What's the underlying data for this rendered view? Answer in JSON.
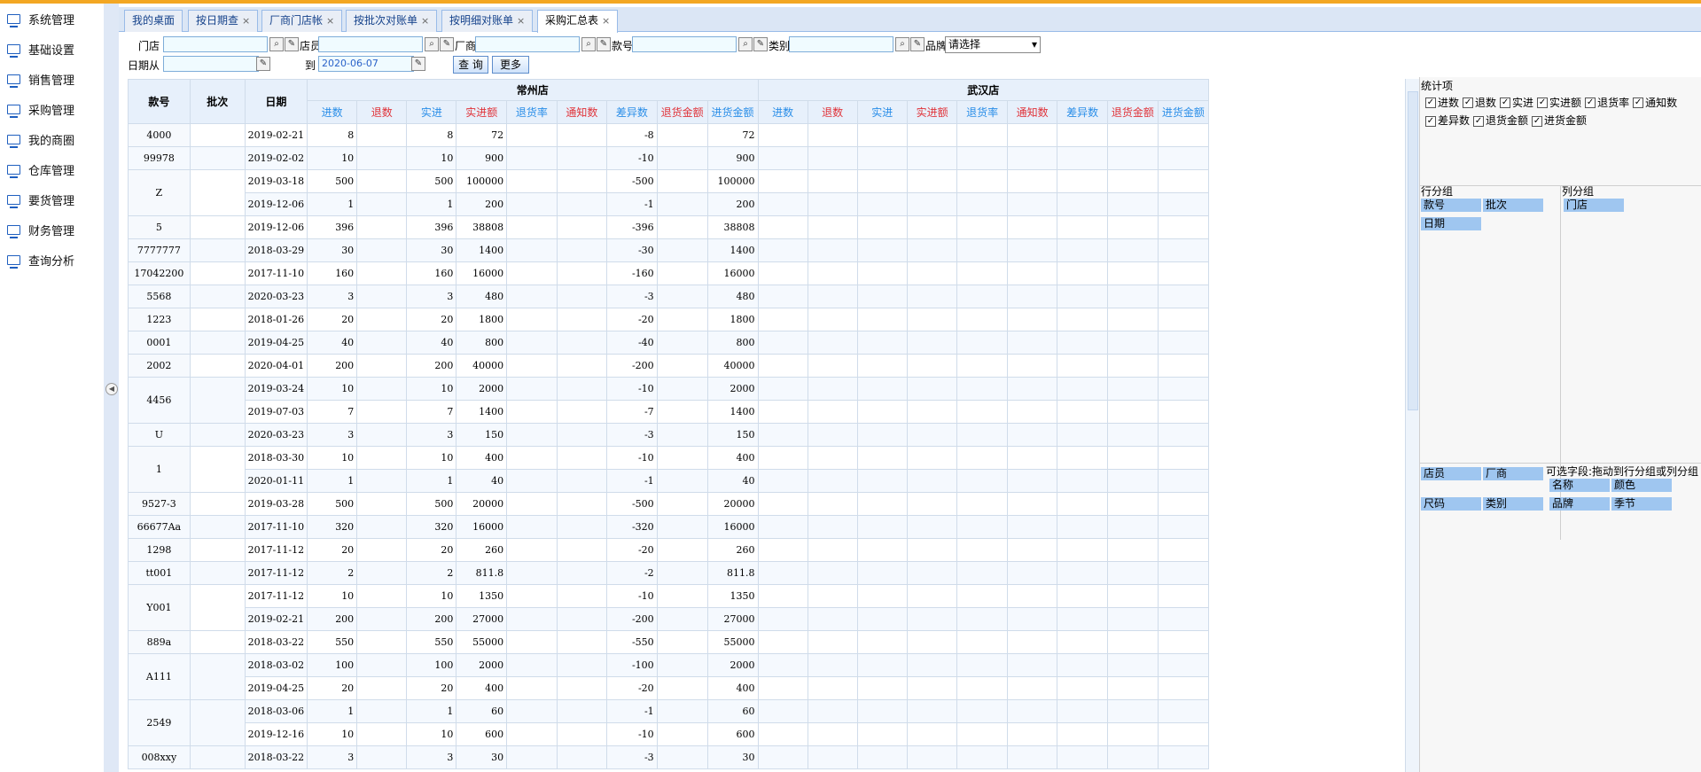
{
  "sidebar": {
    "items": [
      {
        "label": "系统管理"
      },
      {
        "label": "基础设置"
      },
      {
        "label": "销售管理"
      },
      {
        "label": "采购管理"
      },
      {
        "label": "我的商圈"
      },
      {
        "label": "仓库管理"
      },
      {
        "label": "要货管理"
      },
      {
        "label": "财务管理"
      },
      {
        "label": "查询分析"
      }
    ]
  },
  "tabs": [
    {
      "label": "我的桌面",
      "closable": false
    },
    {
      "label": "按日期查",
      "closable": true
    },
    {
      "label": "厂商门店帐",
      "closable": true
    },
    {
      "label": "按批次对账单",
      "closable": true
    },
    {
      "label": "按明细对账单",
      "closable": true
    },
    {
      "label": "采购汇总表",
      "closable": true,
      "active": true
    }
  ],
  "close_glyph": "×",
  "filters": {
    "store_label": "门店",
    "clerk_label": "店员",
    "vendor_label": "厂商",
    "style_label": "款号",
    "category_label": "类别",
    "brand_label": "品牌",
    "brand_value": "请选择",
    "date_from_label": "日期从",
    "date_to_label": "到",
    "date_to_value": "2020-06-07",
    "query_button": "查 询",
    "more_button": "更多"
  },
  "table": {
    "header": {
      "style": "款号",
      "batch": "批次",
      "date": "日期"
    },
    "stores": [
      "常州店",
      "武汉店"
    ],
    "metrics": [
      {
        "label": "进数",
        "color": "blue"
      },
      {
        "label": "退数",
        "color": "red"
      },
      {
        "label": "实进",
        "color": "blue"
      },
      {
        "label": "实进额",
        "color": "red"
      },
      {
        "label": "退货率",
        "color": "blue"
      },
      {
        "label": "通知数",
        "color": "red"
      },
      {
        "label": "差异数",
        "color": "blue"
      },
      {
        "label": "退货金额",
        "color": "red"
      },
      {
        "label": "进货金额",
        "color": "blue"
      }
    ],
    "rows": [
      {
        "style": "4000",
        "date": "2019-02-21",
        "in": "8",
        "actual": "8",
        "amount": "72",
        "diff": "-8",
        "in_amount": "72"
      },
      {
        "style": "99978",
        "date": "2019-02-02",
        "in": "10",
        "actual": "10",
        "amount": "900",
        "diff": "-10",
        "in_amount": "900"
      },
      {
        "style": "Z",
        "date": "2019-03-18",
        "in": "500",
        "actual": "500",
        "amount": "100000",
        "diff": "-500",
        "in_amount": "100000",
        "span": 2
      },
      {
        "style": "",
        "date": "2019-12-06",
        "in": "1",
        "actual": "1",
        "amount": "200",
        "diff": "-1",
        "in_amount": "200",
        "cont": true
      },
      {
        "style": "5",
        "date": "2019-12-06",
        "in": "396",
        "actual": "396",
        "amount": "38808",
        "diff": "-396",
        "in_amount": "38808"
      },
      {
        "style": "7777777",
        "date": "2018-03-29",
        "in": "30",
        "actual": "30",
        "amount": "1400",
        "diff": "-30",
        "in_amount": "1400"
      },
      {
        "style": "17042200",
        "date": "2017-11-10",
        "in": "160",
        "actual": "160",
        "amount": "16000",
        "diff": "-160",
        "in_amount": "16000"
      },
      {
        "style": "5568",
        "date": "2020-03-23",
        "in": "3",
        "actual": "3",
        "amount": "480",
        "diff": "-3",
        "in_amount": "480"
      },
      {
        "style": "1223",
        "date": "2018-01-26",
        "in": "20",
        "actual": "20",
        "amount": "1800",
        "diff": "-20",
        "in_amount": "1800"
      },
      {
        "style": "0001",
        "date": "2019-04-25",
        "in": "40",
        "actual": "40",
        "amount": "800",
        "diff": "-40",
        "in_amount": "800"
      },
      {
        "style": "2002",
        "date": "2020-04-01",
        "in": "200",
        "actual": "200",
        "amount": "40000",
        "diff": "-200",
        "in_amount": "40000"
      },
      {
        "style": "4456",
        "date": "2019-03-24",
        "in": "10",
        "actual": "10",
        "amount": "2000",
        "diff": "-10",
        "in_amount": "2000",
        "span": 2
      },
      {
        "style": "",
        "date": "2019-07-03",
        "in": "7",
        "actual": "7",
        "amount": "1400",
        "diff": "-7",
        "in_amount": "1400",
        "cont": true
      },
      {
        "style": "U",
        "date": "2020-03-23",
        "in": "3",
        "actual": "3",
        "amount": "150",
        "diff": "-3",
        "in_amount": "150"
      },
      {
        "style": "1",
        "date": "2018-03-30",
        "in": "10",
        "actual": "10",
        "amount": "400",
        "diff": "-10",
        "in_amount": "400",
        "span": 2
      },
      {
        "style": "",
        "date": "2020-01-11",
        "in": "1",
        "actual": "1",
        "amount": "40",
        "diff": "-1",
        "in_amount": "40",
        "cont": true
      },
      {
        "style": "9527-3",
        "date": "2019-03-28",
        "in": "500",
        "actual": "500",
        "amount": "20000",
        "diff": "-500",
        "in_amount": "20000"
      },
      {
        "style": "66677Aa",
        "date": "2017-11-10",
        "in": "320",
        "actual": "320",
        "amount": "16000",
        "diff": "-320",
        "in_amount": "16000"
      },
      {
        "style": "1298",
        "date": "2017-11-12",
        "in": "20",
        "actual": "20",
        "amount": "260",
        "diff": "-20",
        "in_amount": "260"
      },
      {
        "style": "tt001",
        "date": "2017-11-12",
        "in": "2",
        "actual": "2",
        "amount": "811.8",
        "diff": "-2",
        "in_amount": "811.8"
      },
      {
        "style": "Y001",
        "date": "2017-11-12",
        "in": "10",
        "actual": "10",
        "amount": "1350",
        "diff": "-10",
        "in_amount": "1350",
        "span": 2
      },
      {
        "style": "",
        "date": "2019-02-21",
        "in": "200",
        "actual": "200",
        "amount": "27000",
        "diff": "-200",
        "in_amount": "27000",
        "cont": true
      },
      {
        "style": "889a",
        "date": "2018-03-22",
        "in": "550",
        "actual": "550",
        "amount": "55000",
        "diff": "-550",
        "in_amount": "55000"
      },
      {
        "style": "A111",
        "date": "2018-03-02",
        "in": "100",
        "actual": "100",
        "amount": "2000",
        "diff": "-100",
        "in_amount": "2000",
        "span": 2
      },
      {
        "style": "",
        "date": "2019-04-25",
        "in": "20",
        "actual": "20",
        "amount": "400",
        "diff": "-20",
        "in_amount": "400",
        "cont": true
      },
      {
        "style": "2549",
        "date": "2018-03-06",
        "in": "1",
        "actual": "1",
        "amount": "60",
        "diff": "-1",
        "in_amount": "60",
        "span": 2
      },
      {
        "style": "",
        "date": "2019-12-16",
        "in": "10",
        "actual": "10",
        "amount": "600",
        "diff": "-10",
        "in_amount": "600",
        "cont": true
      },
      {
        "style": "008xxy",
        "date": "2018-03-22",
        "in": "3",
        "actual": "3",
        "amount": "30",
        "diff": "-3",
        "in_amount": "30"
      }
    ]
  },
  "panel": {
    "stat_title": "统计项",
    "stat_items": [
      {
        "label": "进数",
        "checked": true
      },
      {
        "label": "退数",
        "checked": true
      },
      {
        "label": "实进",
        "checked": true
      },
      {
        "label": "实进额",
        "checked": true
      },
      {
        "label": "退货率",
        "checked": true
      },
      {
        "label": "通知数",
        "checked": true
      },
      {
        "label": "差异数",
        "checked": true
      },
      {
        "label": "退货金额",
        "checked": true
      },
      {
        "label": "进货金额",
        "checked": true
      }
    ],
    "check_glyph": "✓",
    "row_group_title": "行分组",
    "row_group_fields": [
      "款号",
      "批次",
      "日期"
    ],
    "col_group_title": "列分组",
    "col_group_fields": [
      "门店"
    ],
    "optional_title": "可选字段:拖动到行分组或列分组",
    "optional_fields_left": [
      "店员",
      "厂商",
      "尺码",
      "类别"
    ],
    "optional_fields_right": [
      "名称",
      "颜色",
      "品牌",
      "季节"
    ]
  }
}
